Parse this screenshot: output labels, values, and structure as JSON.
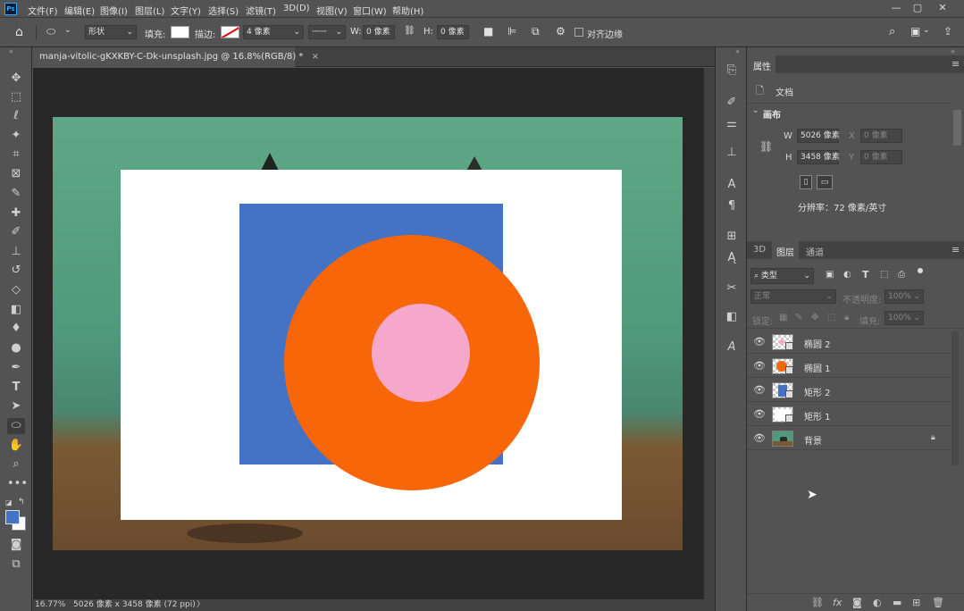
{
  "app": {
    "logo": "Ps"
  },
  "menus": [
    "文件(F)",
    "编辑(E)",
    "图像(I)",
    "图层(L)",
    "文字(Y)",
    "选择(S)",
    "滤镜(T)",
    "3D(D)",
    "视图(V)",
    "窗口(W)",
    "帮助(H)"
  ],
  "window_controls": {
    "minimize": "—",
    "maximize": "▢",
    "close": "✕"
  },
  "options": {
    "mode": "形状",
    "fill_label": "填充:",
    "stroke_label": "描边:",
    "stroke_width": "4 像素",
    "w_label": "W:",
    "w_value": "0 像素",
    "h_label": "H:",
    "h_value": "0 像素",
    "align_edges": "对齐边缘"
  },
  "document": {
    "tab_title": "manja-vitolic-gKXKBY-C-Dk-unsplash.jpg @ 16.8%(RGB/8) *",
    "close": "×"
  },
  "status": {
    "zoom": "16.77%",
    "info": "5026 像素 x 3458 像素 (72 ppi)",
    "arrow": "〉"
  },
  "properties": {
    "tab": "属性",
    "doc_label": "文档",
    "canvas_section": "画布",
    "w_label": "W",
    "w_value": "5026 像素",
    "h_label": "H",
    "h_value": "3458 像素",
    "x_label": "X",
    "x_placeholder": "0 像素",
    "y_label": "Y",
    "y_placeholder": "0 像素",
    "resolution": "分辨率：72 像素/英寸"
  },
  "layers_panel": {
    "tabs": [
      "3D",
      "图层",
      "通道"
    ],
    "filter_kind": "类型",
    "blend_mode": "正常",
    "opacity_label": "不透明度:",
    "opacity_value": "100%",
    "lock_label": "锁定:",
    "fill_label": "填充:",
    "fill_value": "100%",
    "layers": [
      {
        "name": "椭圆 2",
        "color": "#f6a8cc"
      },
      {
        "name": "椭圆 1",
        "color": "#f76609"
      },
      {
        "name": "矩形 2",
        "color": "#4472c4"
      },
      {
        "name": "矩形 1",
        "color": "#ffffff"
      },
      {
        "name": "背景",
        "color": "#4f9a7c"
      }
    ]
  },
  "colors": {
    "foreground": "#4472c4",
    "background": "#ffffff"
  }
}
